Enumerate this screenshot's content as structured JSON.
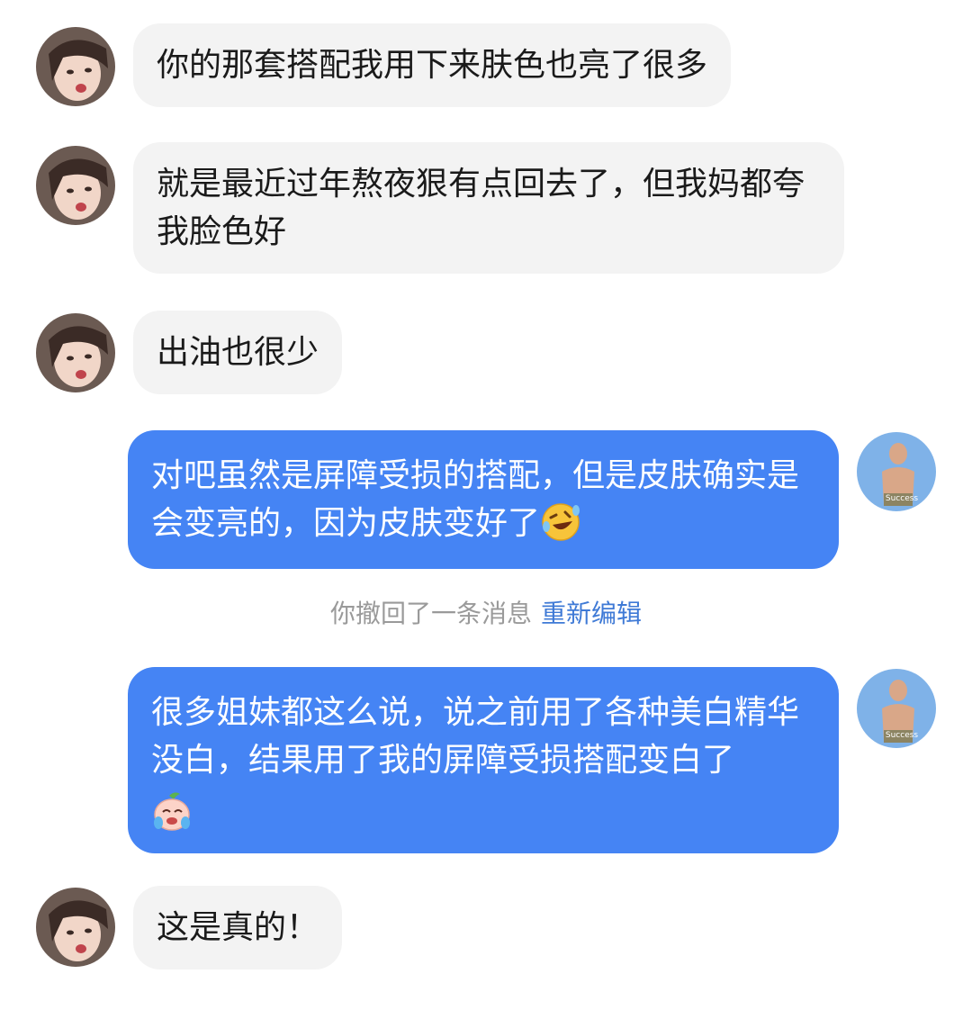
{
  "messages": [
    {
      "sender": "other",
      "text": "你的那套搭配我用下来肤色也亮了很多"
    },
    {
      "sender": "other",
      "text": "就是最近过年熬夜狠有点回去了，但我妈都夸我脸色好"
    },
    {
      "sender": "other",
      "text": "出油也很少"
    },
    {
      "sender": "me",
      "text": "对吧虽然是屏障受损的搭配，但是皮肤确实是会变亮的，因为皮肤变好了",
      "emoji": "rolling-on-floor-laughing-emoji"
    },
    {
      "sender": "me",
      "text": "很多姐妹都这么说，说之前用了各种美白精华没白，结果用了我的屏障受损搭配变白了",
      "emoji": "crying-peach-emoji"
    },
    {
      "sender": "other",
      "text": "这是真的！"
    }
  ],
  "recall_notice": {
    "text": "你撤回了一条消息",
    "action_label": "重新编辑"
  },
  "avatar_caption": "Success",
  "colors": {
    "outgoing_bubble": "#4584f4",
    "incoming_bubble": "#f3f3f3",
    "link": "#3f7ad6"
  }
}
